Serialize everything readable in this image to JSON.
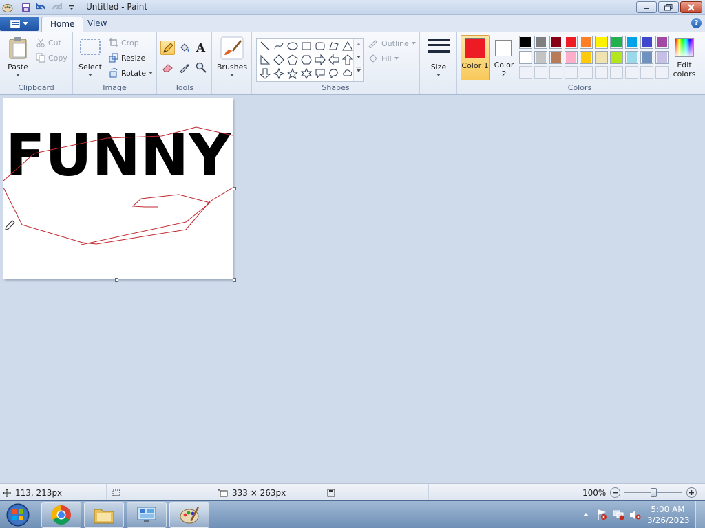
{
  "window": {
    "title": "Untitled - Paint",
    "minimize_icon": "minimize-icon",
    "maximize_icon": "restore-icon",
    "close_icon": "close-icon"
  },
  "quick_access": [
    "paint-icon",
    "save-icon",
    "undo-icon",
    "redo-icon",
    "customize-dropdown-icon"
  ],
  "tabs": [
    {
      "label": "Home",
      "active": true
    },
    {
      "label": "View",
      "active": false
    }
  ],
  "ribbon": {
    "clipboard": {
      "group_label": "Clipboard",
      "paste_label": "Paste",
      "cut_label": "Cut",
      "copy_label": "Copy"
    },
    "image": {
      "group_label": "Image",
      "select_label": "Select",
      "crop_label": "Crop",
      "resize_label": "Resize",
      "rotate_label": "Rotate"
    },
    "tools": {
      "group_label": "Tools",
      "items": [
        "pencil-icon",
        "fill-bucket-icon",
        "text-icon",
        "eraser-icon",
        "color-picker-icon",
        "magnifier-icon"
      ],
      "selected": "pencil-icon"
    },
    "brushes": {
      "label": "Brushes"
    },
    "shapes": {
      "group_label": "Shapes",
      "outline_label": "Outline",
      "fill_label": "Fill"
    },
    "size": {
      "label": "Size"
    },
    "colors": {
      "group_label": "Colors",
      "color1_label": "Color 1",
      "color2_label": "Color 2",
      "color1": "#ed1c24",
      "color2": "#ffffff",
      "edit_label": "Edit colors",
      "palette_row1": [
        "#000000",
        "#7f7f7f",
        "#880015",
        "#ed1c24",
        "#ff7f27",
        "#fff200",
        "#22b14c",
        "#00a2e8",
        "#3f48cc",
        "#a349a4"
      ],
      "palette_row2": [
        "#ffffff",
        "#c3c3c3",
        "#b97a57",
        "#ffaec9",
        "#ffc90e",
        "#efe4b0",
        "#b5e61d",
        "#99d9ea",
        "#7092be",
        "#c8bfe7"
      ]
    }
  },
  "canvas": {
    "text": "FUNNY!",
    "stroke_color": "#c0272d"
  },
  "statusbar": {
    "cursor_position": "113, 213px",
    "canvas_size": "333 × 263px",
    "zoom": "100%",
    "zoom_slider_value_percent": 50
  },
  "taskbar": {
    "time": "5:00 AM",
    "date": "3/26/2023",
    "apps": [
      "chrome-icon",
      "file-explorer-icon",
      "control-panel-icon",
      "paint-icon"
    ]
  }
}
